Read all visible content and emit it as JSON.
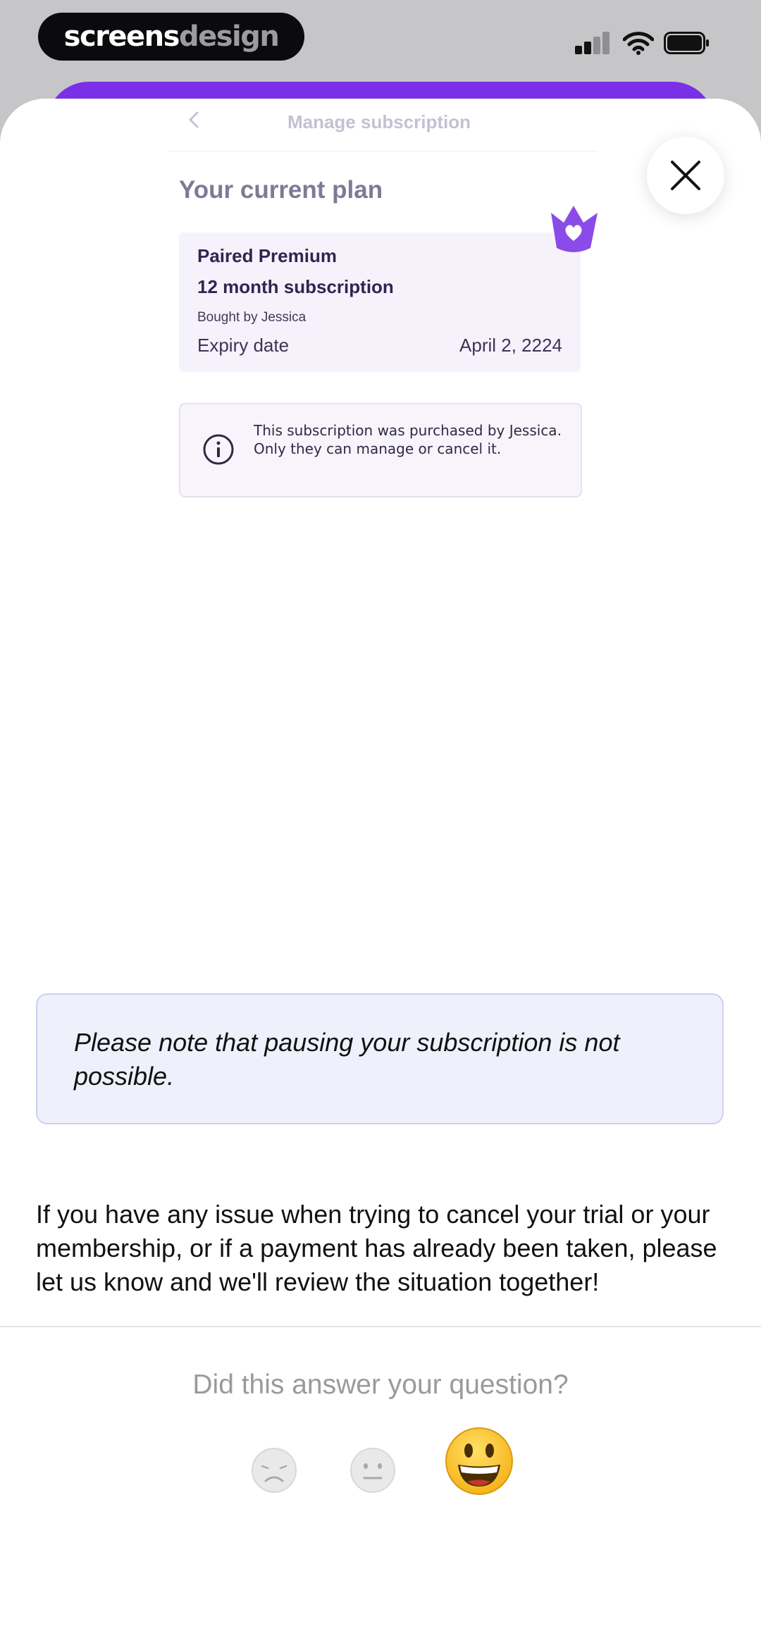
{
  "status_bar": {
    "brand_part1": "screens",
    "brand_part2": "design"
  },
  "preview": {
    "nav_title": "Manage subscription",
    "plan_heading": "Your current plan",
    "plan": {
      "name": "Paired Premium",
      "term": "12 month subscription",
      "buyer": "Bought by Jessica",
      "expiry_label": "Expiry date",
      "expiry_value": "April 2, 2224"
    },
    "info_text": "This subscription was purchased by Jessica. Only they can manage or cancel it."
  },
  "note": "Please note that pausing your subscription is not possible.",
  "body_text": "If you have any issue when trying to cancel your trial or your membership, or if a payment has already been taken, please let us know and we'll review the situation together!",
  "feedback": {
    "question": "Did this answer your question?",
    "options": [
      "sad-face-icon",
      "neutral-face-icon",
      "smiley-face-icon"
    ]
  },
  "colors": {
    "accent_purple": "#7a30e6",
    "plan_card_bg": "#f6f2fb",
    "note_bg": "#eef0fb",
    "emoji_yellow": "#fcc419"
  }
}
